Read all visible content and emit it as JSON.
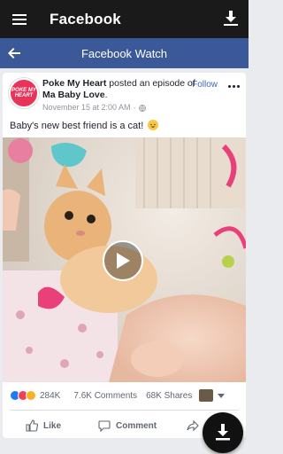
{
  "appbar": {
    "title": "Facebook",
    "menu_icon": "hamburger-icon",
    "download_icon": "download-icon"
  },
  "subbar": {
    "title": "Facebook Watch",
    "back_icon": "arrow-left-icon"
  },
  "post": {
    "avatar_text": "POKE MY HEART",
    "author": "Poke My Heart",
    "action_text": " posted an episode of ",
    "show": "Ma Baby Love",
    "period": ".",
    "time": "November 15 at 2:00 AM",
    "privacy_icon": "globe-icon",
    "follow_label": "· Follow",
    "more_icon": "more-horizontal-icon",
    "caption": "Baby's new best friend is a cat!",
    "caption_emoji": "smiling-cat-emoji"
  },
  "video": {
    "play_icon": "play-icon"
  },
  "stats": {
    "reactions": [
      "like",
      "love",
      "haha"
    ],
    "reaction_colors": [
      "#2078f4",
      "#f33e58",
      "#f7b125"
    ],
    "reaction_count": "284K",
    "comments": "7.6K Comments",
    "shares": "68K Shares"
  },
  "actions": {
    "like": "Like",
    "comment": "Comment",
    "share": "S"
  },
  "fab": {
    "icon": "download-icon"
  }
}
